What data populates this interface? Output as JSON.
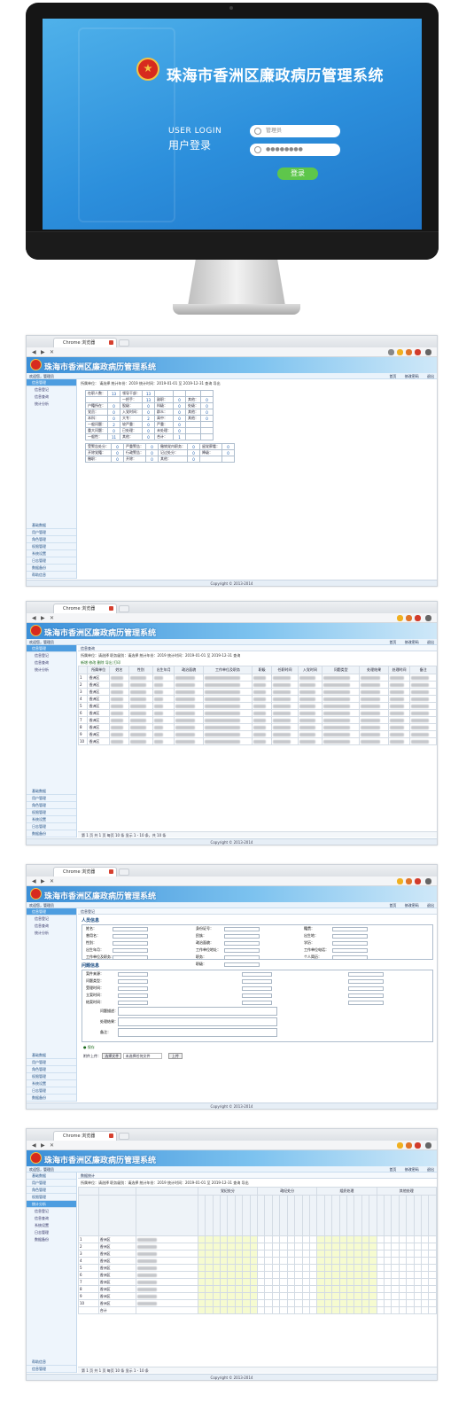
{
  "login": {
    "system_title": "珠海市香洲区廉政病历管理系统",
    "label_en": "USER LOGIN",
    "label_cn": "用户登录",
    "username_placeholder": "管理员",
    "password_placeholder": "●●●●●●●●",
    "login_button": "登录"
  },
  "browser": {
    "tab_title": "Chrome 浏览器"
  },
  "app": {
    "title": "珠海市香洲区廉政病历管理系统",
    "user_bar_left": "欢迎您，管理员",
    "user_bar_right": [
      "首页",
      "修改密码",
      "退出"
    ],
    "copyright": "Copyright © 2013-2014"
  },
  "sidebar": {
    "top_items": [
      "信息管理",
      "信息登记",
      "信息查询",
      "统计分析"
    ],
    "bottom_items": [
      "基础数据",
      "用户管理",
      "角色管理",
      "权限管理",
      "系统设置",
      "日志管理",
      "数据备份",
      "帮助信息"
    ]
  },
  "screen1": {
    "filter": "所属单位： 请选择   统计年份：2019   统计时间：2019-01-01  至  2019-12-31   查询   导出",
    "rows": [
      [
        "在职人数：",
        "13",
        "领导干部：",
        "13",
        "",
        "",
        "",
        ""
      ],
      [
        "",
        "",
        "一把手：",
        "13",
        "副职：",
        "0",
        "其他：",
        "0"
      ],
      [
        "户籍所在：",
        "0",
        "股级：",
        "0",
        "科级：",
        "0",
        "处级：",
        "0"
      ],
      [
        "党员：",
        "0",
        "入党时间：",
        "0",
        "群众：",
        "0",
        "其他：",
        "0"
      ],
      [
        "本科：",
        "0",
        "大专：",
        "2",
        "高中：",
        "0",
        "其他：",
        "0"
      ],
      [
        "一般问题：",
        "2",
        "较严重：",
        "0",
        "严重：",
        "0",
        "",
        ""
      ],
      [
        "重大问题：",
        "0",
        "已处理：",
        "0",
        "未处理：",
        "0",
        "",
        ""
      ],
      [
        "一般性：",
        "11",
        "其他：",
        "0",
        "合计：",
        "1",
        "",
        ""
      ]
    ],
    "rows2": [
      [
        "受警告处分：",
        "0",
        "严重警告：",
        "0",
        "撤销党内职务：",
        "0",
        "留党察看：",
        "0"
      ],
      [
        "开除党籍：",
        "0",
        "行政警告：",
        "0",
        "记过处分：",
        "0",
        "降级：",
        "0"
      ],
      [
        "撤职：",
        "0",
        "开除：",
        "0",
        "其他：",
        "0",
        "",
        ""
      ]
    ]
  },
  "screen2": {
    "crumb": "信息查询",
    "filter": "所属单位：请选择   职务级别：请选择   统计年份：2019   统计时间：2019-01-01 至 2019-12-31   查询",
    "toolbar": "新增  修改  删除  导出  打印",
    "headers": [
      "所属单位",
      "姓名",
      "性别",
      "出生年月",
      "政治面貌",
      "工作单位及职务",
      "职级",
      "任职时间",
      "入党时间",
      "问题类型",
      "处理结果",
      "处理时间",
      "备注"
    ],
    "row_numbers": [
      "1",
      "2",
      "3",
      "4",
      "5",
      "6",
      "7",
      "8",
      "9",
      "10"
    ],
    "units": [
      "香洲区",
      "香洲区",
      "香洲区",
      "香洲区",
      "香洲区",
      "香洲区",
      "香洲区",
      "香洲区",
      "香洲区",
      "香洲区"
    ],
    "pager": "第 1 页  共 1 页   每页 10 条   显示 1 - 10 条，共 10 条"
  },
  "screen3": {
    "crumb": "信息登记",
    "section1": "人员信息",
    "section2": "问题信息",
    "fields_left": [
      "姓名：",
      "曾用名：",
      "性别：",
      "出生年月：",
      "工作单位及职务："
    ],
    "fields_mid": [
      "身份证号：",
      "民族：",
      "政治面貌：",
      "工作单位地址：",
      "职务：",
      "职级："
    ],
    "fields_right": [
      "籍贯：",
      "出生地：",
      "学历：",
      "工作单位电话：",
      "个人简历："
    ],
    "p_fields": [
      "案件来源：",
      "问题类型：",
      "受理时间：",
      "立案时间：",
      "结案时间："
    ],
    "textareas": [
      "问题描述：",
      "处理结果：",
      "备注："
    ],
    "status": "保存",
    "upload_label": "附件上传：",
    "upload_btn": "选择文件",
    "upload_hint": "未选择任何文件",
    "upload_submit": "上传"
  },
  "screen4": {
    "crumb": "数据统计",
    "filter": "所属单位：请选择   职务级别：请选择   统计年份：2019   统计时间：2019-01-01  至  2019-12-31   查询   导出",
    "group_headers": [
      "党纪处分",
      "政纪处分",
      "组织处理",
      "其他处理"
    ],
    "row_numbers": [
      "1",
      "2",
      "3",
      "4",
      "5",
      "6",
      "7",
      "8",
      "9",
      "10"
    ],
    "units": [
      "香洲区",
      "香洲区",
      "香洲区",
      "香洲区",
      "香洲区",
      "香洲区",
      "香洲区",
      "香洲区",
      "香洲区",
      "香洲区"
    ],
    "total_label": "合计",
    "pager": "第 1 页  共 1 页   每页 10 条   显示 1 - 10 条"
  }
}
